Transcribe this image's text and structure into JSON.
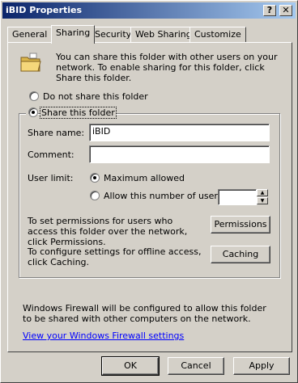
{
  "window": {
    "title": "iBID Properties",
    "help_label": "?",
    "close_label": "✕"
  },
  "tabs": [
    {
      "label": "General"
    },
    {
      "label": "Sharing"
    },
    {
      "label": "Security"
    },
    {
      "label": "Web Sharing"
    },
    {
      "label": "Customize"
    }
  ],
  "sharing": {
    "intro": "You can share this folder with other users on your network. To enable sharing for this folder, click Share this folder.",
    "do_not_share_label": "Do not share this folder",
    "share_label": "Share this folder",
    "share_name_label": "Share name:",
    "share_name_value": "iBID",
    "comment_label": "Comment:",
    "comment_value": "",
    "user_limit_label": "User limit:",
    "max_allowed_label": "Maximum allowed",
    "allow_number_label": "Allow this number of users:",
    "allow_number_value": "",
    "permissions_text": "To set permissions for users who access this folder over the network, click Permissions.",
    "permissions_button": "Permissions",
    "caching_text": "To configure settings for offline access, click Caching.",
    "caching_button": "Caching",
    "firewall_text": "Windows Firewall will be configured to allow this folder to be shared with other computers on the network.",
    "firewall_link": "View your Windows Firewall settings"
  },
  "buttons": {
    "ok": "OK",
    "cancel": "Cancel",
    "apply": "Apply"
  },
  "icons": {
    "folder": "folder-icon",
    "spin_up": "▲",
    "spin_down": "▼"
  },
  "state": {
    "selected_tab": "Sharing",
    "share_mode": "share",
    "user_limit_mode": "maximum"
  }
}
